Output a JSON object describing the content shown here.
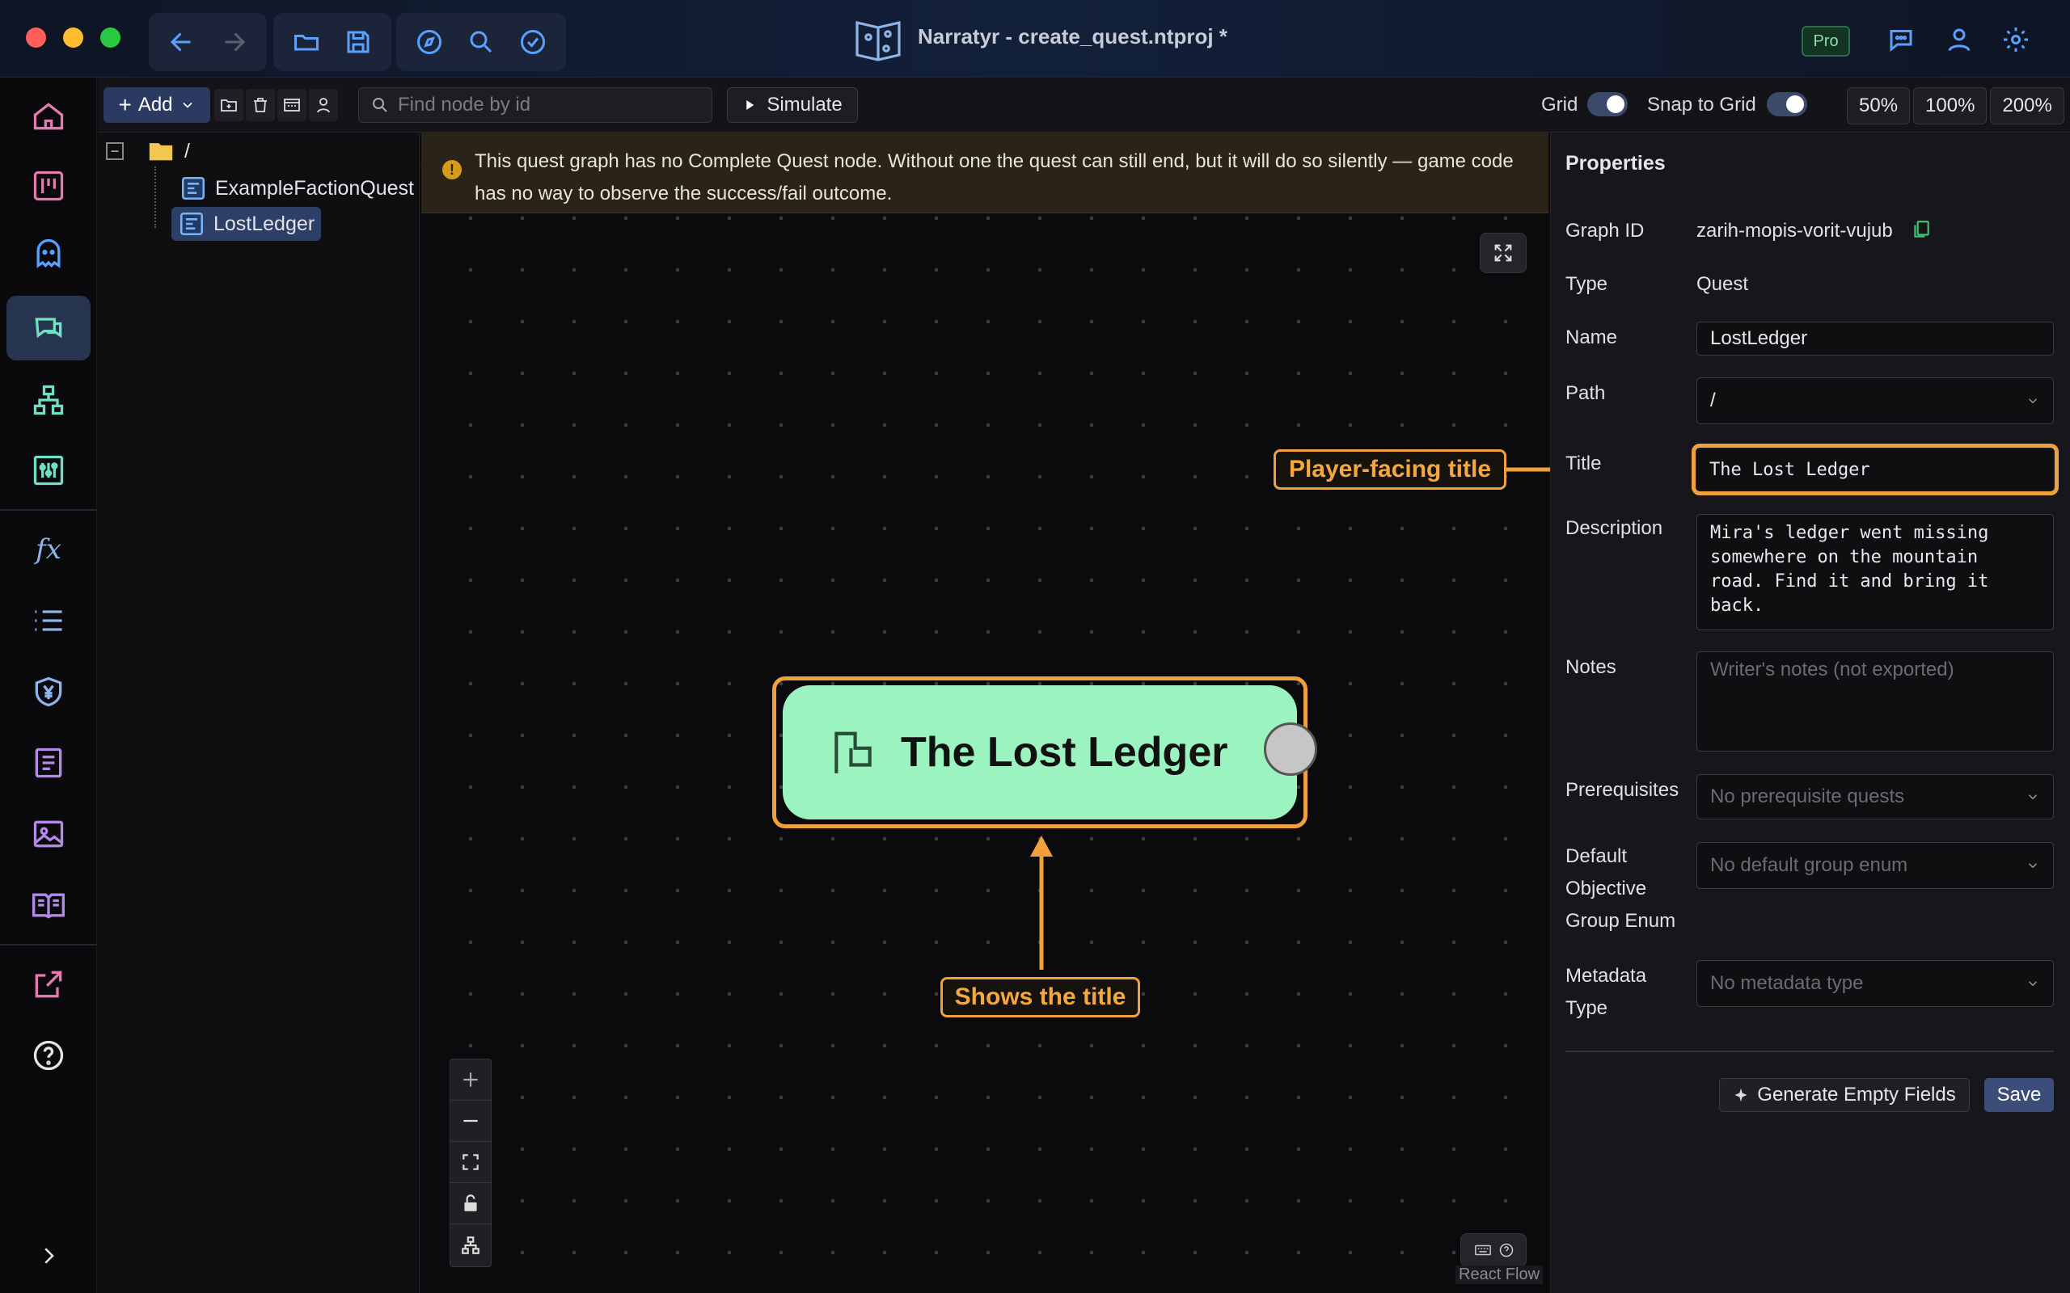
{
  "window": {
    "title": "Narratyr - create_quest.ntproj *",
    "pro_badge": "Pro"
  },
  "toolbar": {
    "add_label": "Add",
    "search_placeholder": "Find node by id",
    "simulate_label": "Simulate",
    "grid_label": "Grid",
    "grid_on": true,
    "snap_label": "Snap to Grid",
    "snap_on": true,
    "zoom_options": [
      "50%",
      "100%",
      "200%"
    ]
  },
  "tree": {
    "root": "/",
    "items": [
      {
        "label": "ExampleFactionQuest",
        "selected": false
      },
      {
        "label": "LostLedger",
        "selected": true
      }
    ]
  },
  "warning": {
    "text": "This quest graph has no Complete Quest node. Without one the quest can still end, but it will do so silently — game code has no way to observe the success/fail outcome."
  },
  "canvas": {
    "node_title": "The Lost Ledger",
    "callout_node": "Shows the title",
    "callout_field": "Player-facing title",
    "attribution": "React Flow"
  },
  "properties": {
    "heading": "Properties",
    "graph_id_label": "Graph ID",
    "graph_id_value": "zarih-mopis-vorit-vujub",
    "type_label": "Type",
    "type_value": "Quest",
    "name_label": "Name",
    "name_value": "LostLedger",
    "path_label": "Path",
    "path_value": "/",
    "title_label": "Title",
    "title_value": "The Lost Ledger",
    "description_label": "Description",
    "description_value": "Mira's ledger went missing somewhere on the mountain road. Find it and bring it back.",
    "notes_label": "Notes",
    "notes_placeholder": "Writer's notes (not exported)",
    "prereq_label": "Prerequisites",
    "prereq_placeholder": "No prerequisite quests",
    "default_group_label": "Default Objective Group Enum",
    "default_group_placeholder": "No default group enum",
    "metadata_label": "Metadata Type",
    "metadata_placeholder": "No metadata type",
    "generate_label": "Generate Empty Fields",
    "save_label": "Save"
  },
  "colors": {
    "accent": "#f0a03c",
    "node": "#9bf3bf",
    "warning_bg": "#2a2418"
  }
}
